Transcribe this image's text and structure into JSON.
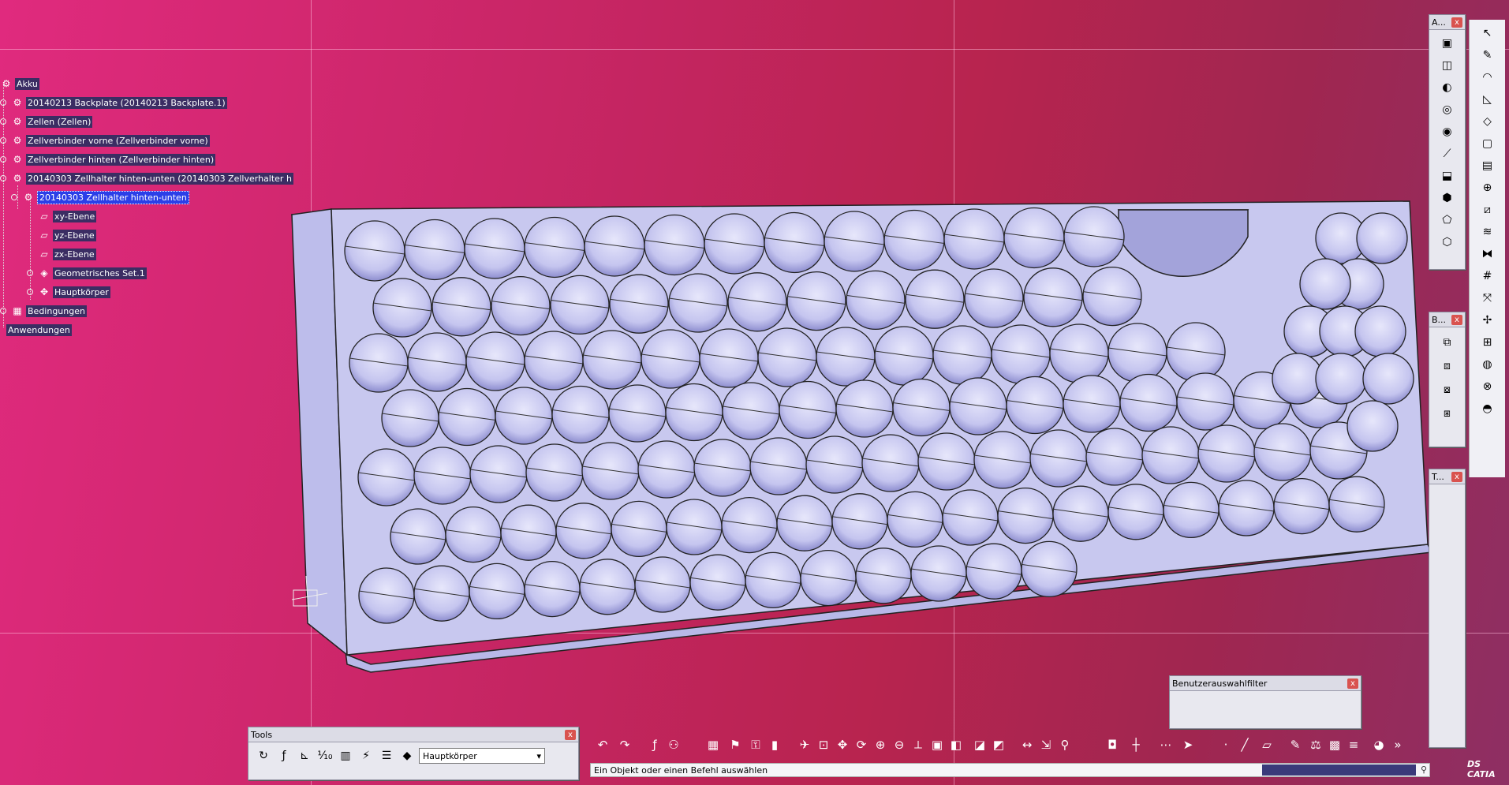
{
  "tree": {
    "root": "Akku",
    "items": [
      "20140213 Backplate (20140213 Backplate.1)",
      "Zellen (Zellen)",
      "Zellverbinder vorne (Zellverbinder vorne)",
      "Zellverbinder hinten (Zellverbinder hinten)",
      "20140303 Zellhalter hinten-unten (20140303 Zellverhalter h",
      "20140303 Zellhalter hinten-unten",
      "xy-Ebene",
      "yz-Ebene",
      "zx-Ebene",
      "Geometrisches Set.1",
      "Hauptkörper",
      "Bedingungen",
      "Anwendungen"
    ]
  },
  "toolbars": {
    "a_title": "A...",
    "b_title": "B...",
    "t_title": "T...",
    "tools_title": "Tools",
    "tools_dropdown": "Hauptkörper",
    "filter_title": "Benutzerauswahlfilter"
  },
  "status": {
    "prompt": "Ein Objekt oder einen Befehl auswählen"
  },
  "brand": {
    "logo": "DS CATIA"
  },
  "colors": {
    "part_face": "#c9c9ef",
    "part_dark": "#9b9bd6",
    "tree_label_bg": "#3b2d63",
    "selection": "#2b3fe8"
  }
}
